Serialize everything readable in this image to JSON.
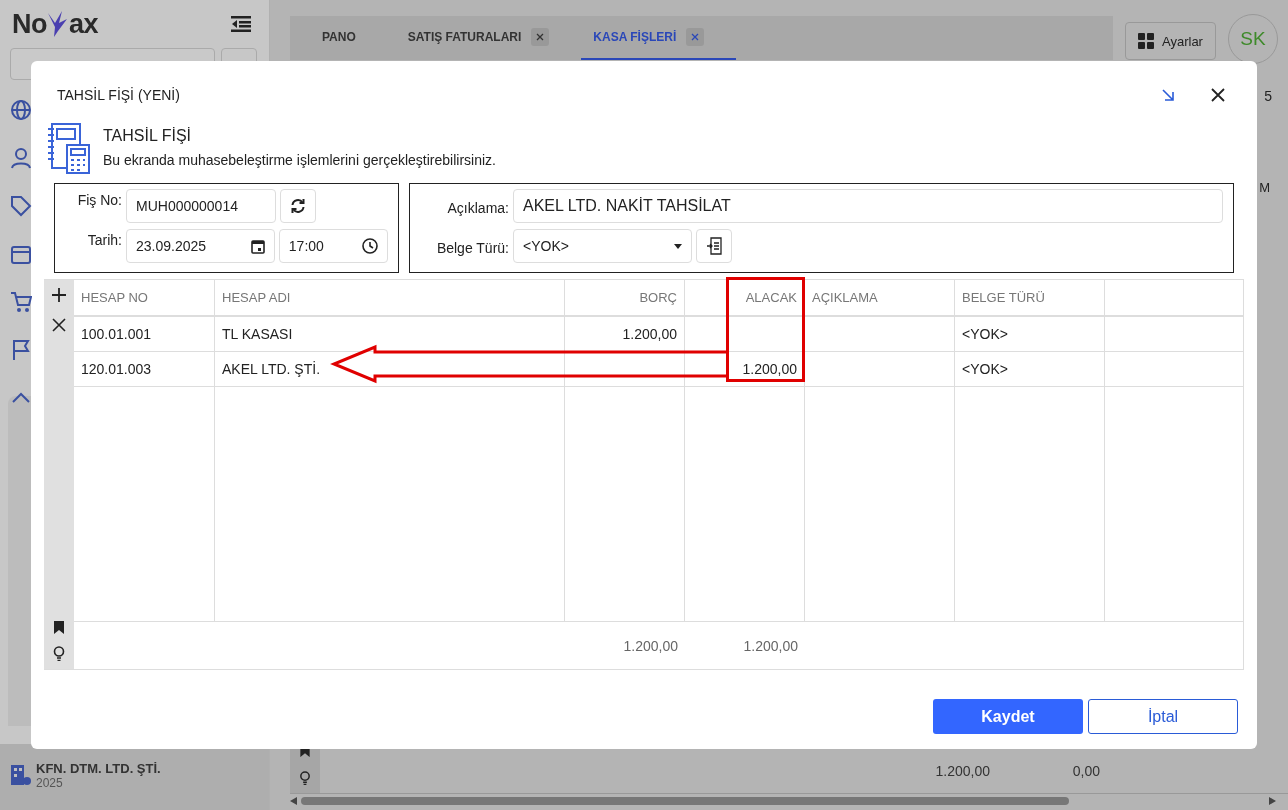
{
  "app": {
    "logo_start": "No",
    "logo_end": "ax",
    "company": "KFN. DTM. LTD. ŞTİ.",
    "year": "2025"
  },
  "sidebar": {
    "items": [
      {
        "kind": "globe"
      },
      {
        "kind": "user"
      },
      {
        "kind": "tag"
      },
      {
        "kind": "box"
      },
      {
        "kind": "cart"
      },
      {
        "kind": "flag"
      },
      {
        "kind": "chevron",
        "expanded": true
      }
    ]
  },
  "tabs": [
    {
      "label": "PANO",
      "selected": false,
      "closable": false
    },
    {
      "label": "SATIŞ FATURALARI",
      "selected": false,
      "closable": true
    },
    {
      "label": "KASA FİŞLERİ",
      "selected": true,
      "closable": true
    }
  ],
  "toolbar": {
    "settings": "Ayarlar",
    "avatar": "SK"
  },
  "background_fragments": [
    "5",
    "M"
  ],
  "background_totals": [
    "1.200,00",
    "0,00"
  ],
  "dialog": {
    "title": "TAHSİL FİŞİ (YENİ)",
    "heading": "TAHSİL FİŞİ",
    "subtitle": "Bu ekranda muhasebeleştirme işlemlerini gerçekleştirebilirsiniz.",
    "fis_no": {
      "label": "Fiş No:",
      "value": "MUH000000014"
    },
    "tarih": {
      "label": "Tarih:",
      "date": "23.09.2025",
      "time": "17:00"
    },
    "aciklama": {
      "label": "Açıklama:",
      "value": "AKEL LTD. NAKİT TAHSİLAT"
    },
    "belge_turu": {
      "label": "Belge Türü:",
      "value": "<YOK>"
    },
    "grid": {
      "columns": [
        "HESAP NO",
        "HESAP ADI",
        "BORÇ",
        "ALACAK",
        "AÇIKLAMA",
        "BELGE TÜRÜ"
      ],
      "rows": [
        {
          "hesap_no": "100.01.001",
          "hesap_adi": "TL KASASI",
          "borc": "1.200,00",
          "belge_turu": "<YOK>"
        },
        {
          "hesap_no": "120.01.003",
          "hesap_adi": "AKEL LTD. ŞTİ.",
          "alacak": "1.200,00",
          "belge_turu": "<YOK>"
        }
      ],
      "totals": {
        "borc": "1.200,00",
        "alacak": "1.200,00"
      }
    },
    "buttons": [
      {
        "label": "Kaydet",
        "kind": "primary"
      },
      {
        "label": "İptal",
        "kind": "secondary"
      }
    ]
  }
}
